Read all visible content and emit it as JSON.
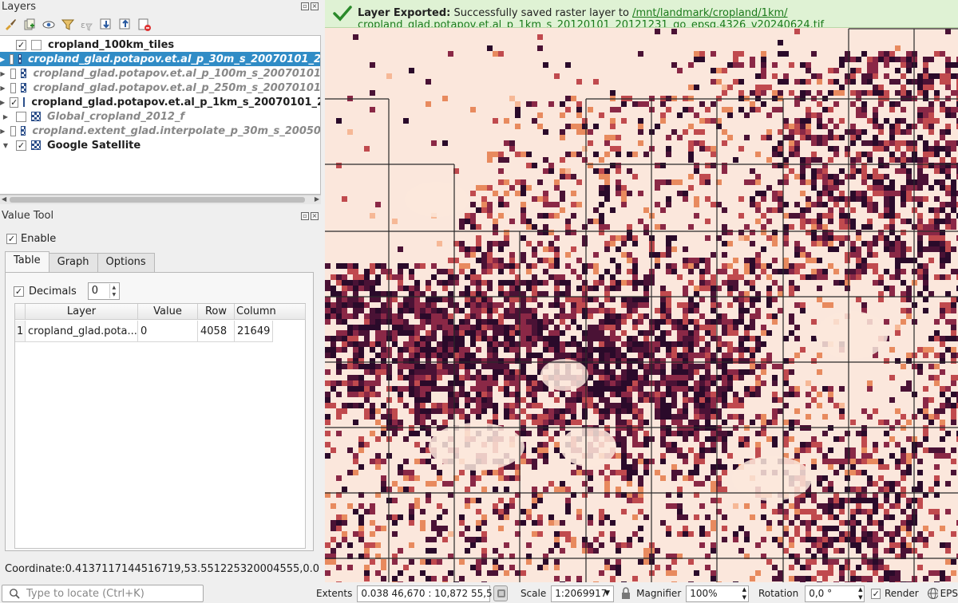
{
  "layers_panel": {
    "title": "Layers",
    "toolbar_icons": [
      "style-brush-icon",
      "add-group-icon",
      "eye-icon",
      "filter-icon",
      "filter-expression-icon",
      "expand-all-icon",
      "collapse-all-icon",
      "remove-layer-icon"
    ],
    "layers": [
      {
        "name": "cropland_100km_tiles",
        "checked": true,
        "type": "vector",
        "style": "bold",
        "expandable": false,
        "selected": false
      },
      {
        "name": "cropland_glad.potapov.et.al_p_30m_s_20070101_2",
        "checked": false,
        "type": "raster",
        "style": "italic",
        "expandable": true,
        "selected": true
      },
      {
        "name": "cropland_glad.potapov.et.al_p_100m_s_20070101",
        "checked": false,
        "type": "raster",
        "style": "italic",
        "expandable": true,
        "selected": false
      },
      {
        "name": "cropland_glad.potapov.et.al_p_250m_s_20070101",
        "checked": false,
        "type": "raster",
        "style": "italic",
        "expandable": true,
        "selected": false
      },
      {
        "name": "cropland_glad.potapov.et.al_p_1km_s_20070101_2",
        "checked": true,
        "type": "raster",
        "style": "bold",
        "expandable": true,
        "selected": false
      },
      {
        "name": "Global_cropland_2012_f",
        "checked": false,
        "type": "raster",
        "style": "italic",
        "expandable": true,
        "selected": false
      },
      {
        "name": "cropland.extent_glad.interpolate_p_30m_s_20050",
        "checked": false,
        "type": "raster",
        "style": "italic",
        "expandable": true,
        "selected": false
      },
      {
        "name": "Google Satellite",
        "checked": true,
        "type": "raster",
        "style": "bold",
        "expandable": true,
        "expanded": true,
        "selected": false
      }
    ]
  },
  "value_tool": {
    "title": "Value Tool",
    "enable_label": "Enable",
    "enable_checked": true,
    "tabs": [
      "Table",
      "Graph",
      "Options"
    ],
    "active_tab": "Table",
    "decimals_label": "Decimals",
    "decimals_checked": true,
    "decimals_value": "0",
    "table": {
      "headers": [
        "Layer",
        "Value",
        "Row",
        "Column"
      ],
      "rows": [
        {
          "index": "1",
          "layer": "cropland_glad.pota...",
          "value": "0",
          "row": "4058",
          "column": "21649"
        }
      ]
    },
    "coordinate_text": "Coordinate:0.4137117144516719,53.551225320004555,0.0"
  },
  "locator": {
    "placeholder": "Type to locate (Ctrl+K)"
  },
  "message_bar": {
    "title": "Layer Exported:",
    "text": "Successfully saved raster layer to",
    "link_part1": "/mnt/landmark/cropland/1km/",
    "link_part2": "cropland_glad.potapov.et.al_p_1km_s_20120101_20121231_go_epsg.4326_v20240624.tif"
  },
  "status_bar": {
    "extents_label": "Extents",
    "extents_value": "0.038 46,670 : 10,872 55,511",
    "scale_label": "Scale",
    "scale_value": "1:2069917",
    "magnifier_label": "Magnifier",
    "magnifier_value": "100%",
    "rotation_label": "Rotation",
    "rotation_value": "0,0 °",
    "render_label": "Render",
    "render_checked": true,
    "crs_label": "EPS"
  },
  "colors": {
    "selection": "#308cc6",
    "message_bg": "#dff2d4",
    "map_background": "#fbe7dc",
    "raster_dark": "#2a0a2a",
    "raster_mid": "#8a2846",
    "raster_light": "#e88a5e"
  }
}
